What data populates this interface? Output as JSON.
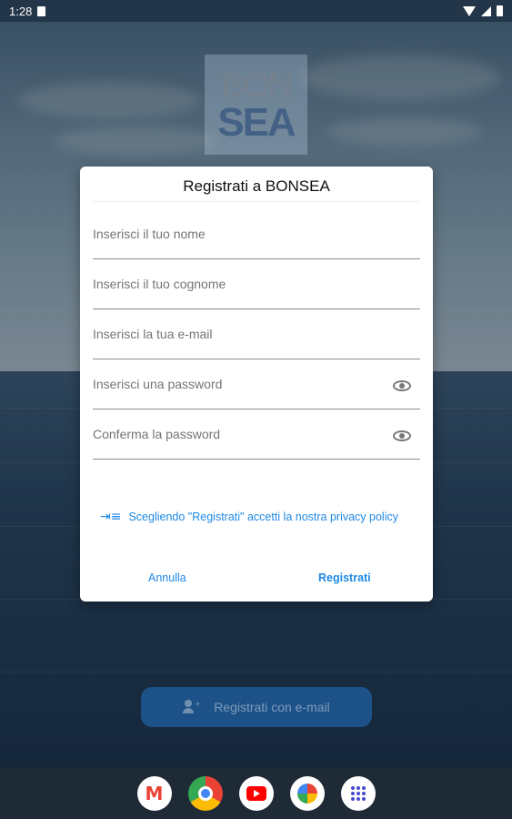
{
  "status_bar": {
    "time": "1:28"
  },
  "logo": {
    "line1": "BON",
    "line2": "SEA"
  },
  "dialog": {
    "title": "Registrati a BONSEA",
    "fields": [
      {
        "placeholder": "Inserisci il tuo nome"
      },
      {
        "placeholder": "Inserisci il tuo cognome"
      },
      {
        "placeholder": "Inserisci la tua e-mail"
      },
      {
        "placeholder": "Inserisci una password"
      },
      {
        "placeholder": "Conferma la password"
      }
    ],
    "privacy_text": "Scegliendo \"Registrati\" accetti la nostra privacy policy",
    "cancel_label": "Annulla",
    "register_label": "Registrati"
  },
  "email_button": {
    "label": "Registrati con e-mail"
  },
  "dock": {
    "apps": [
      "gmail",
      "chrome",
      "youtube",
      "photos",
      "app-drawer"
    ]
  },
  "colors": {
    "accent": "#1e88e5",
    "email_button_bg": "#1d5289",
    "status_bar_bg": "#233548"
  }
}
